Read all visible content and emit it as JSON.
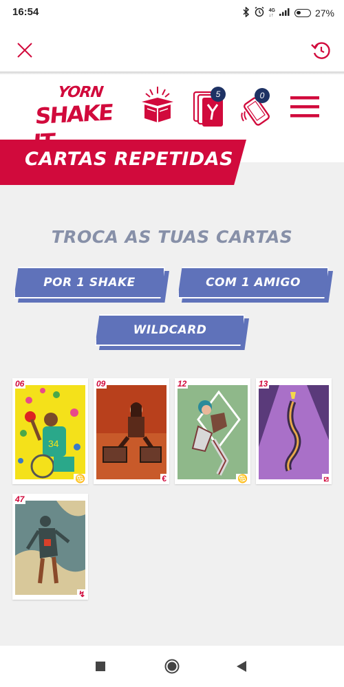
{
  "status_bar": {
    "time": "16:54",
    "network": "4G",
    "battery_percent": "27%",
    "icons": [
      "bluetooth-icon",
      "alarm-icon",
      "signal-icon",
      "battery-icon"
    ]
  },
  "toolbar": {
    "close_icon": "close-icon",
    "refresh_icon": "refresh-icon"
  },
  "header": {
    "logo_top": "YORN",
    "logo_bottom": "SHAKE IT",
    "cards_badge": "5",
    "shake_badge": "0",
    "icons": [
      "gift-box-icon",
      "cards-icon",
      "phone-shake-icon",
      "menu-icon"
    ]
  },
  "section": {
    "title": "CARTAS REPETIDAS",
    "subtitle": "TROCA AS TUAS CARTAS"
  },
  "buttons": {
    "shake": "POR 1 SHAKE",
    "friend": "COM 1 AMIGO",
    "wildcard": "WILDCARD"
  },
  "cards": [
    {
      "number": "06",
      "symbol": "♋",
      "accent": "#f4e11a"
    },
    {
      "number": "09",
      "symbol": "€",
      "accent": "#b8401c"
    },
    {
      "number": "12",
      "symbol": "♋",
      "accent": "#8fb88a"
    },
    {
      "number": "13",
      "symbol": "⧄",
      "accent": "#a970c8"
    },
    {
      "number": "47",
      "symbol": "↯",
      "accent": "#6a8a8a"
    }
  ],
  "colors": {
    "brand_red": "#d10a3c",
    "button_blue": "#5f72ba",
    "badge_navy": "#1e3264",
    "subtitle_grey": "#8790a8"
  },
  "nav": {
    "icons": [
      "recent-apps-icon",
      "home-icon",
      "back-icon"
    ]
  }
}
